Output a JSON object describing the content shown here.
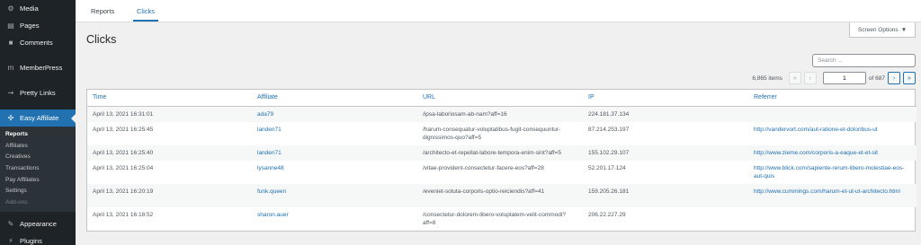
{
  "sidebar": {
    "items_top": [
      {
        "label": "Media",
        "icon": "media-icon"
      },
      {
        "label": "Pages",
        "icon": "pages-icon"
      },
      {
        "label": "Comments",
        "icon": "comments-icon"
      }
    ],
    "memberpress": {
      "label": "MemberPress",
      "icon": "memberpress-icon"
    },
    "prettylinks": {
      "label": "Pretty Links",
      "icon": "pretty-links-icon"
    },
    "easy_affiliate": {
      "label": "Easy Affiliate",
      "icon": "easy-affiliate-icon"
    },
    "submenu": [
      "Reports",
      "Affiliates",
      "Creatives",
      "Transactions",
      "Pay Affiliates",
      "Settings",
      "Add-ons"
    ],
    "items_bottom": [
      {
        "label": "Appearance",
        "icon": "appearance-icon"
      },
      {
        "label": "Plugins",
        "icon": "plugins-icon"
      }
    ]
  },
  "tabs": [
    "Reports",
    "Clicks"
  ],
  "page_title": "Clicks",
  "screen_options": "Screen Options",
  "search": {
    "placeholder": "Search ...",
    "value": ""
  },
  "pagination": {
    "items": "6,865 items",
    "current": "1",
    "of": "of 687"
  },
  "table": {
    "headers": [
      "Time",
      "Affiliate",
      "URL",
      "IP",
      "Referrer"
    ],
    "rows": [
      {
        "time": "April 13, 2021 16:31:01",
        "affiliate": "ada79",
        "url": "/ipsa-laboriosam-ab-nam?aff=16",
        "ip": "224.181.37.134",
        "referrer": ""
      },
      {
        "time": "April 13, 2021 16:25:45",
        "affiliate": "landen71",
        "url": "/harum-consequatur-voluptatibus-fugit-consequuntur-dignissimos-quo?aff=5",
        "ip": "87.214.253.197",
        "referrer": "http://vandervort.com/aut-ratione-et-doloribus-ut"
      },
      {
        "time": "April 13, 2021 16:25:40",
        "affiliate": "landen71",
        "url": "/architecto-et-repellat-labore-tempora-enim-sint?aff=5",
        "ip": "155.102.29.107",
        "referrer": "http://www.zieme.com/corporis-a-eaque-et-et-sit"
      },
      {
        "time": "April 13, 2021 16:25:04",
        "affiliate": "lysanne48",
        "url": "/vitae-provident-consectetur-facere-eos?aff=28",
        "ip": "52.201.17.124",
        "referrer": "http://www.blick.com/sapiente-rerum-libero-molestiae-eos-aut-quis"
      },
      {
        "time": "April 13, 2021 16:20:19",
        "affiliate": "funk.queen",
        "url": "/eveniet-soluta-corporis-optio-reiciendis?aff=41",
        "ip": "159.205.26.181",
        "referrer": "http://www.cummings.com/harum-et-ut-ut-architecto.html"
      },
      {
        "time": "April 13, 2021 16:18:52",
        "affiliate": "sharon.auer",
        "url": "/consectetur-dolorem-libero-voluptatem-velit-commodi?aff=8",
        "ip": "206.22.227.29",
        "referrer": ""
      }
    ]
  },
  "colors": {
    "sidebar": "#1d2327",
    "accent": "#2271b1",
    "submenu": "#2c3338"
  }
}
